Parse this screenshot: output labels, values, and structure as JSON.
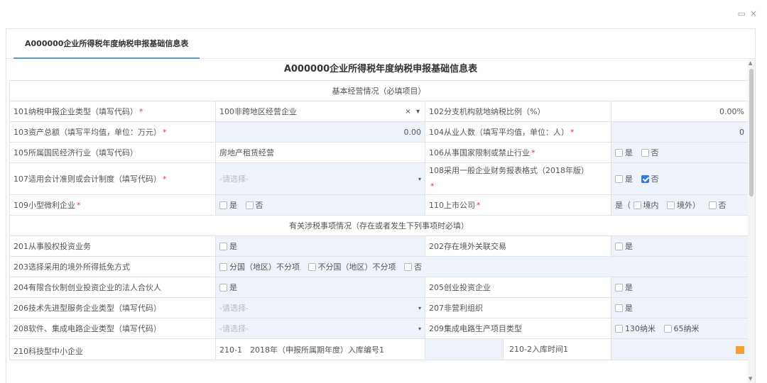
{
  "window": {
    "minimize_glyph": "▭",
    "close_glyph": "×"
  },
  "tab": {
    "label": "A000000企业所得税年度纳税申报基础信息表"
  },
  "form": {
    "title": "A000000企业所得税年度纳税申报基础信息表",
    "section1": "基本经营情况（必填项目）",
    "section2": "有关涉税事项情况（存在或者发生下列事项时必填）",
    "r101_label": "101纳税申报企业类型（填写代码）",
    "r101_value": "100非跨地区经营企业",
    "r101_icons": "× ▾",
    "r102_label": "102分支机构就地纳税比例（%）",
    "r102_value": "0.00%",
    "r103_label": "103资产总额（填写平均值，单位：万元）",
    "r103_value": "0.00",
    "r104_label": "104从业人数（填写平均值，单位：人）",
    "r104_value": "0",
    "r105_label": "105所属国民经济行业（填写代码）",
    "r105_value": "房地产租赁经营",
    "r106_label": "106从事国家限制或禁止行业",
    "r107_label": "107适用会计准则或会计制度（填写代码）",
    "r107_placeholder": "-请选择-",
    "r108_label": "108采用一般企业财务报表格式（2018年版）",
    "r109_label": "109小型微利企业",
    "r110_label": "110上市公司",
    "r110_yes_prefix": "是（",
    "r110_domestic": "境内",
    "r110_foreign": "境外）",
    "r201_label": "201从事股权投资业务",
    "r202_label": "202存在境外关联交易",
    "r203_label": "203选择采用的境外所得抵免方式",
    "r203_opt1": "分国（地区）不分项",
    "r203_opt2": "不分国（地区）不分项",
    "r204_label": "204有限合伙制创业投资企业的法人合伙人",
    "r205_label": "205创业投资企业",
    "r206_label": "206技术先进型服务企业类型（填写代码）",
    "r206_placeholder": "-请选择-",
    "r207_label": "207非营利组织",
    "r208_label": "208软件、集成电路企业类型（填写代码）",
    "r208_placeholder": "-请选择-",
    "r209_label": "209集成电路生产项目类型",
    "r209_opt1": "130纳米",
    "r209_opt2": "65纳米",
    "r210_label": "210科技型中小企业",
    "r210_1_label": "210-1　2018年（申报所属期年度）入库编号1",
    "r210_2_label": "210-2入库时间1",
    "yes": "是",
    "no": "否",
    "caret": "▾"
  },
  "scroll": {
    "up": "▲",
    "down": "▼"
  },
  "colors": {
    "accent": "#5b9bd5",
    "required": "#e33333",
    "input_bg": "#eef3fb",
    "checked": "#2d7be6"
  }
}
